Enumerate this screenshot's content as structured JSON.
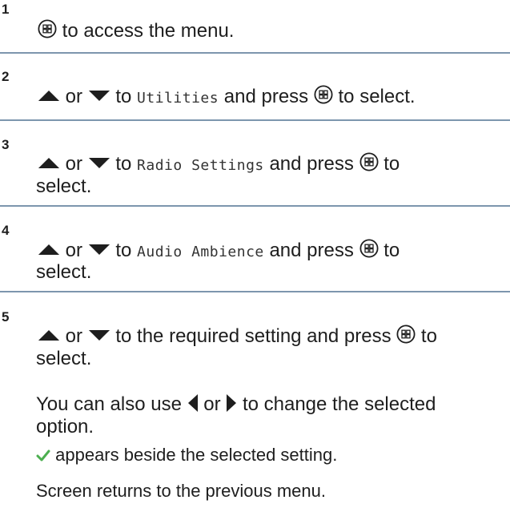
{
  "steps": [
    {
      "number": "1",
      "text_after_button": "to access the menu."
    },
    {
      "number": "2",
      "or": "or",
      "to": "to",
      "target": "Utilities",
      "and_press": "and press",
      "to_select": "to select."
    },
    {
      "number": "3",
      "or": "or",
      "to": "to",
      "target": "Radio Settings",
      "and_press": "and press",
      "select": "select."
    },
    {
      "number": "4",
      "or": "or",
      "to": "to",
      "target": "Audio Ambience",
      "and_press": "and press",
      "select": "select."
    },
    {
      "number": "5",
      "or": "or",
      "text": "to the required setting and press",
      "to": "to",
      "select": "select.",
      "note1_a": "You can also use",
      "note1_or": "or",
      "note1_b": "to change the selected",
      "note1_c": "option.",
      "note2": "appears beside the selected setting.",
      "note3": "Screen returns to the previous menu."
    }
  ],
  "icons": {
    "menu_ok_button": "menu-ok-button-icon",
    "up_arrow": "up-arrow-icon",
    "down_arrow": "down-arrow-icon",
    "left_arrow": "left-arrow-icon",
    "right_arrow": "right-arrow-icon",
    "checkmark": "checkmark-icon"
  },
  "colors": {
    "divider": "#7d96ae",
    "checkmark": "#4caf50",
    "text": "#1e1e1e"
  }
}
